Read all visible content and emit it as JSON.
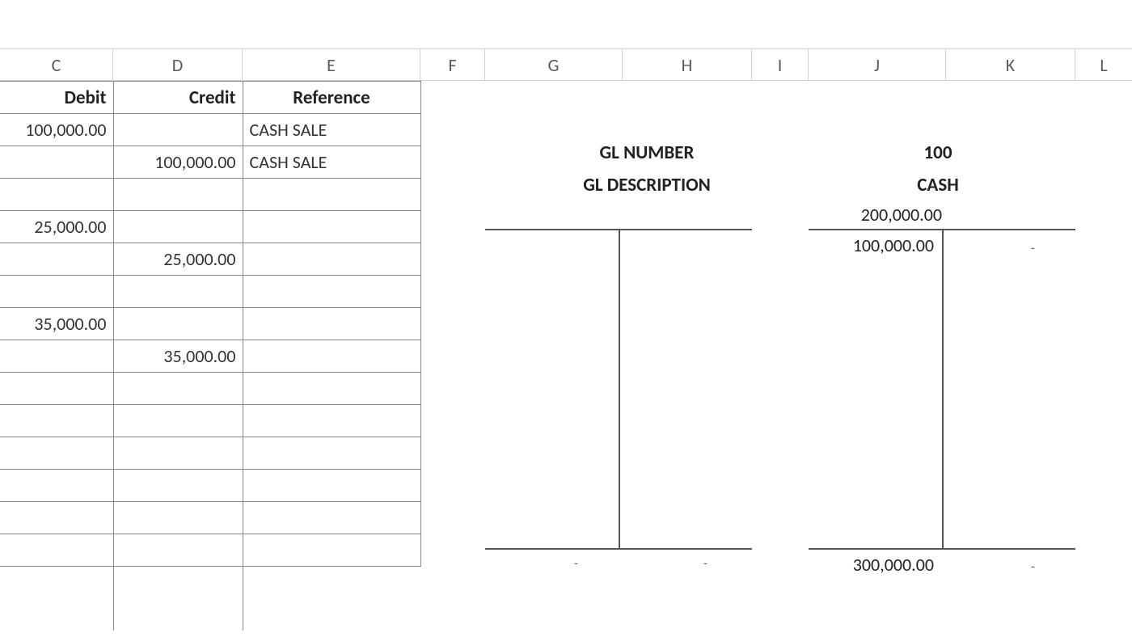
{
  "columns": {
    "C": "C",
    "D": "D",
    "E": "E",
    "F": "F",
    "G": "G",
    "H": "H",
    "I": "I",
    "J": "J",
    "K": "K",
    "L": "L"
  },
  "headers": {
    "debit": "Debit",
    "credit": "Credit",
    "reference": "Reference"
  },
  "rows": [
    {
      "debit": "100,000.00",
      "credit": "",
      "reference": "CASH SALE"
    },
    {
      "debit": "",
      "credit": "100,000.00",
      "reference": "CASH SALE"
    },
    {
      "debit": "",
      "credit": "",
      "reference": ""
    },
    {
      "debit": "25,000.00",
      "credit": "",
      "reference": ""
    },
    {
      "debit": "",
      "credit": "25,000.00",
      "reference": ""
    },
    {
      "debit": "",
      "credit": "",
      "reference": ""
    },
    {
      "debit": "35,000.00",
      "credit": "",
      "reference": ""
    },
    {
      "debit": "",
      "credit": "35,000.00",
      "reference": ""
    },
    {
      "debit": "",
      "credit": "",
      "reference": ""
    },
    {
      "debit": "",
      "credit": "",
      "reference": ""
    },
    {
      "debit": "",
      "credit": "",
      "reference": ""
    },
    {
      "debit": "",
      "credit": "",
      "reference": ""
    },
    {
      "debit": "",
      "credit": "",
      "reference": ""
    },
    {
      "debit": "",
      "credit": "",
      "reference": ""
    }
  ],
  "gl": {
    "number_label": "GL NUMBER",
    "description_label": "GL DESCRIPTION",
    "number_value": "100",
    "description_value": "CASH",
    "balance_above": "200,000.00",
    "t_left_values": [
      "100,000.00"
    ],
    "t_right_values": [
      "-"
    ],
    "left_t_bottom_left": "-",
    "left_t_bottom_right": "-",
    "right_t_bottom_left": "300,000.00",
    "right_t_bottom_right": "-"
  }
}
